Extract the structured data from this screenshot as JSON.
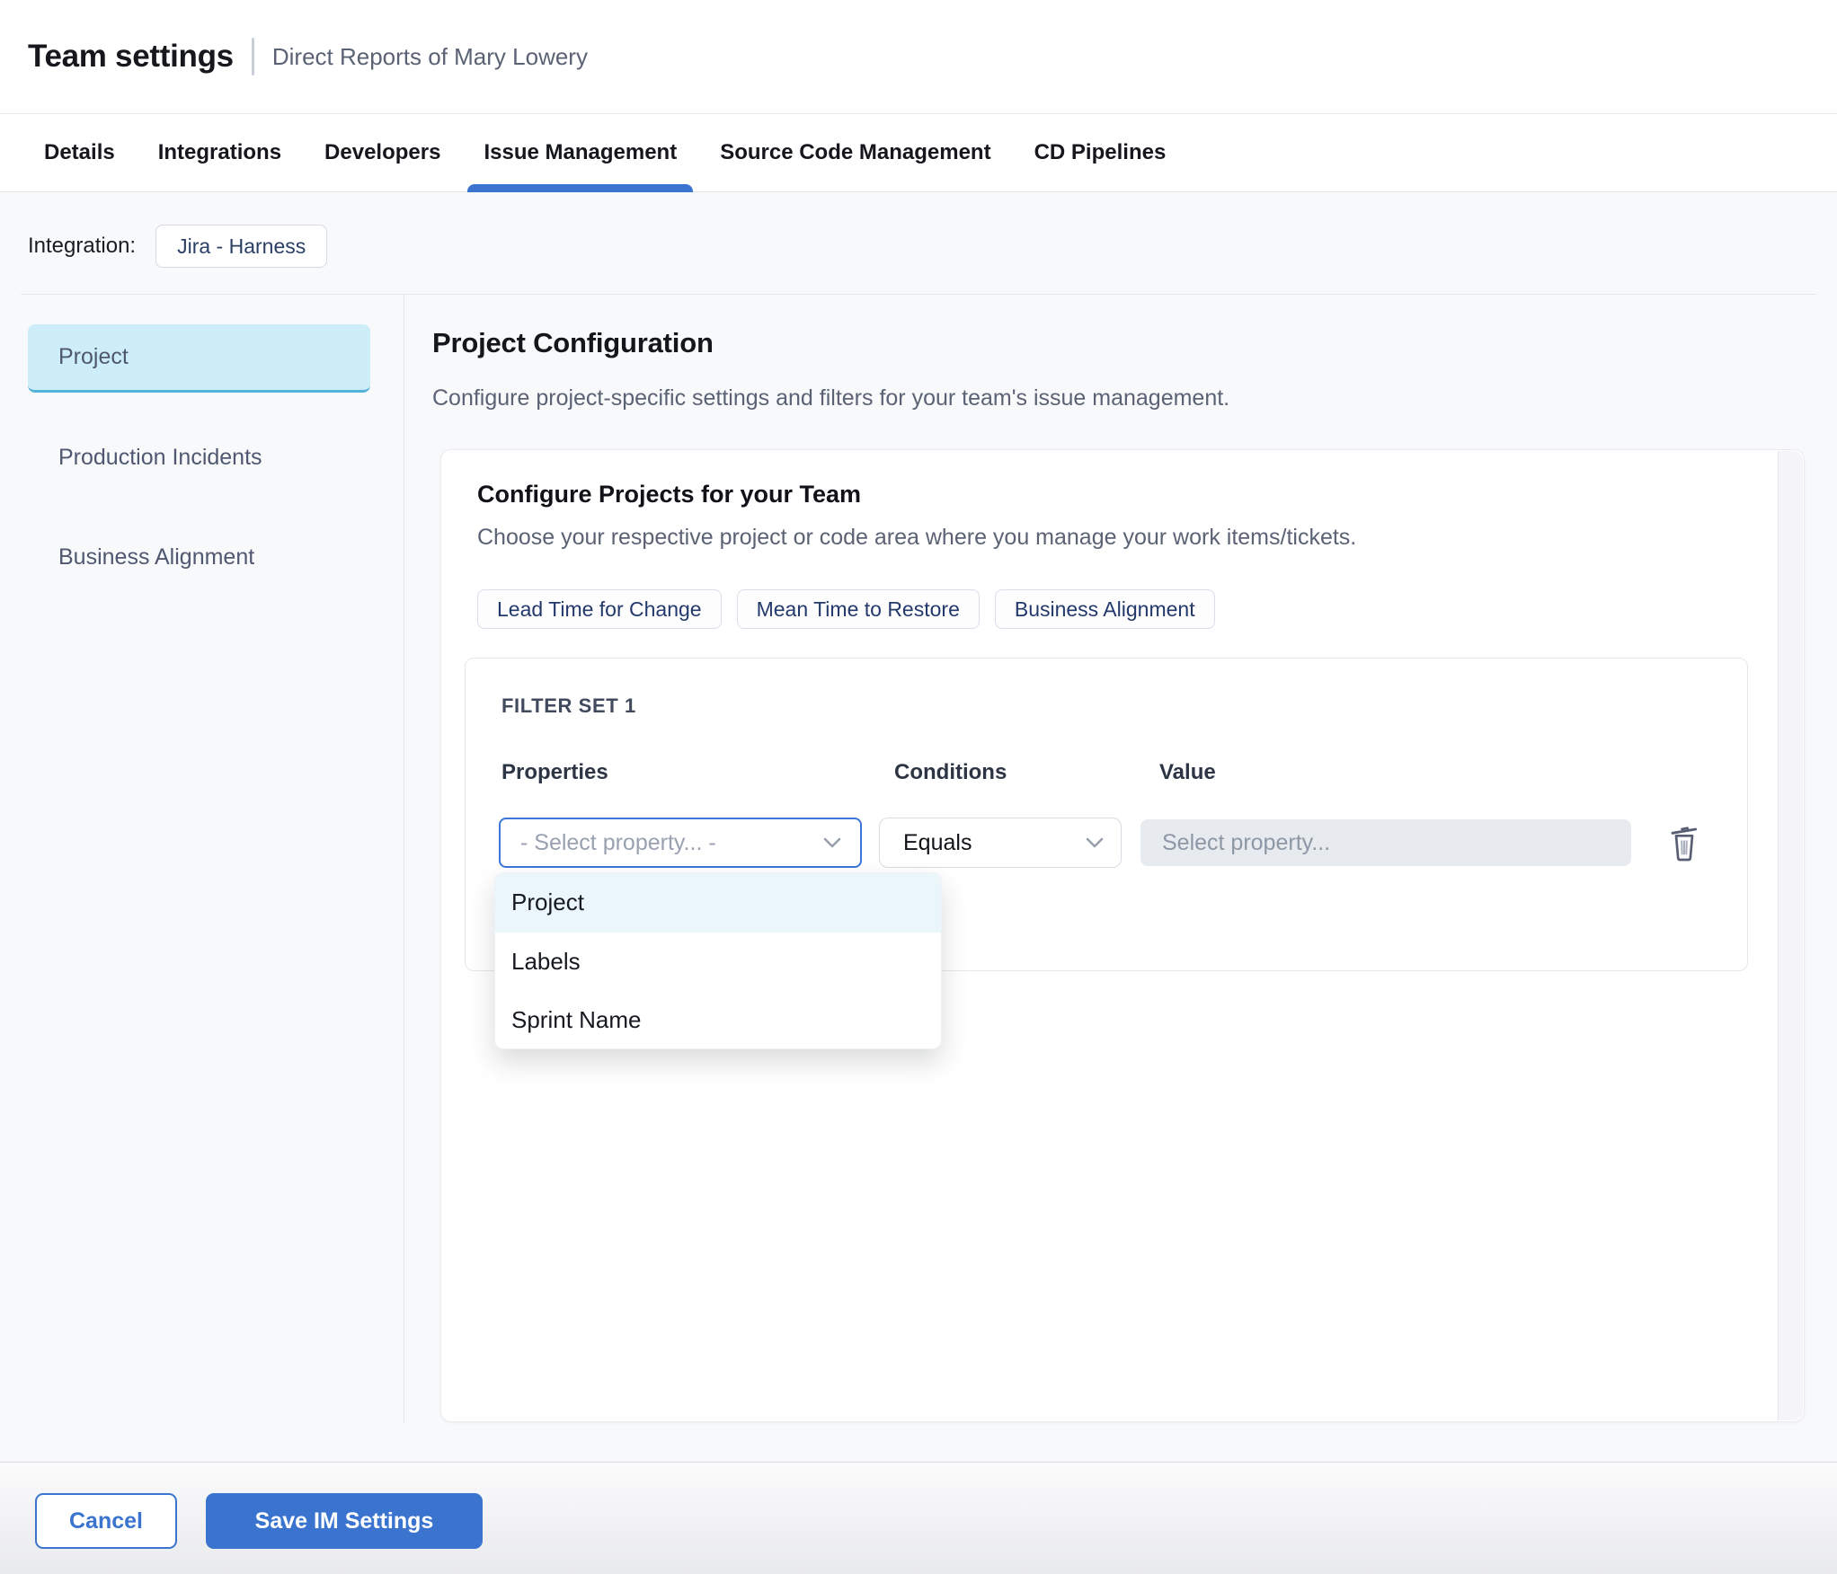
{
  "header": {
    "title": "Team settings",
    "subtitle": "Direct Reports of Mary Lowery"
  },
  "tabs": {
    "items": [
      {
        "label": "Details",
        "active": false
      },
      {
        "label": "Integrations",
        "active": false
      },
      {
        "label": "Developers",
        "active": false
      },
      {
        "label": "Issue Management",
        "active": true
      },
      {
        "label": "Source Code Management",
        "active": false
      },
      {
        "label": "CD Pipelines",
        "active": false
      }
    ]
  },
  "integration": {
    "label": "Integration:",
    "selected": "Jira - Harness"
  },
  "sidebar": {
    "items": [
      {
        "label": "Project",
        "active": true
      },
      {
        "label": "Production Incidents",
        "active": false
      },
      {
        "label": "Business Alignment",
        "active": false
      }
    ]
  },
  "main": {
    "title": "Project Configuration",
    "description": "Configure project-specific settings and filters for your team's issue management."
  },
  "card": {
    "title": "Configure Projects for your Team",
    "description": "Choose your respective project or code area where you manage your work items/tickets.",
    "metric_tabs": [
      {
        "label": "Lead Time for Change"
      },
      {
        "label": "Mean Time to Restore"
      },
      {
        "label": "Business Alignment"
      }
    ]
  },
  "filter_set": {
    "title": "FILTER SET 1",
    "columns": {
      "properties": "Properties",
      "conditions": "Conditions",
      "value": "Value"
    },
    "property_select": {
      "placeholder": "- Select property... -"
    },
    "condition_select": {
      "value": "Equals"
    },
    "value_input": {
      "placeholder": "Select property..."
    }
  },
  "dropdown": {
    "options": [
      {
        "label": "Project",
        "highlighted": true
      },
      {
        "label": "Labels",
        "highlighted": false
      },
      {
        "label": "Sprint Name",
        "highlighted": false
      }
    ]
  },
  "footer": {
    "cancel": "Cancel",
    "save": "Save IM Settings"
  },
  "icons": {
    "property_chevron": "chevron-down",
    "condition_chevron": "chevron-down",
    "delete": "trash"
  },
  "colors": {
    "accent_blue": "#3a74cf",
    "focus_border": "#3b76d8",
    "active_sidebar_bg": "#cdeef9",
    "active_sidebar_border": "#55b2d9",
    "highlighted_option_bg": "#ebf6fb",
    "chip_text": "#23396b",
    "disabled_input_bg": "#e7ebef"
  }
}
